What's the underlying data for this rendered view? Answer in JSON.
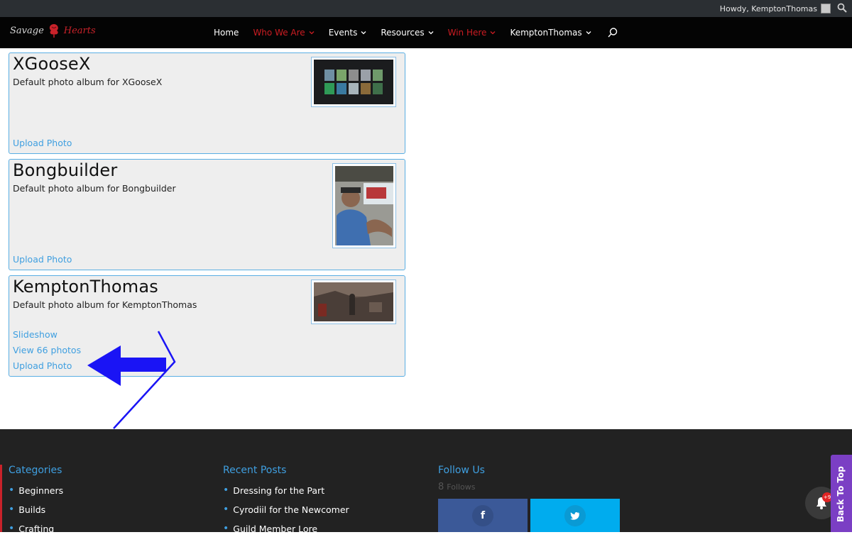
{
  "admin_bar": {
    "greeting": "Howdy, KemptonThomas"
  },
  "header": {
    "logo_text_1": "Savage",
    "logo_text_2": "Hearts",
    "nav": [
      {
        "label": "Home"
      },
      {
        "label": "Who We Are"
      },
      {
        "label": "Events"
      },
      {
        "label": "Resources"
      },
      {
        "label": "Win Here"
      },
      {
        "label": "KemptonThomas"
      }
    ]
  },
  "albums": [
    {
      "title": "XGooseX",
      "description": "Default photo album for XGooseX",
      "links": [
        "Upload Photo"
      ]
    },
    {
      "title": "Bongbuilder",
      "description": "Default photo album for Bongbuilder",
      "links": [
        "Upload Photo"
      ]
    },
    {
      "title": "KemptonThomas",
      "description": "Default photo album for KemptonThomas",
      "links": [
        "Slideshow",
        "View 66 photos",
        "Upload Photo"
      ]
    }
  ],
  "footer": {
    "categories_title": "Categories",
    "categories": [
      "Beginners",
      "Builds",
      "Crafting"
    ],
    "recent_title": "Recent Posts",
    "recent": [
      "Dressing for the Part",
      "Cyrodiil for the Newcomer",
      "Guild Member Lore"
    ],
    "follow_title": "Follow Us",
    "follow_count": "8",
    "follow_label": "Follows"
  },
  "notification_badge": "+9",
  "back_to_top": "Back To Top",
  "colors": {
    "accent_blue": "#3f9fe0",
    "nav_red": "#cc1c22",
    "header_bg": "#040404",
    "footer_bg": "#222222",
    "annotation_arrow": "#1a14f5",
    "back_to_top": "#7b3fc4"
  }
}
